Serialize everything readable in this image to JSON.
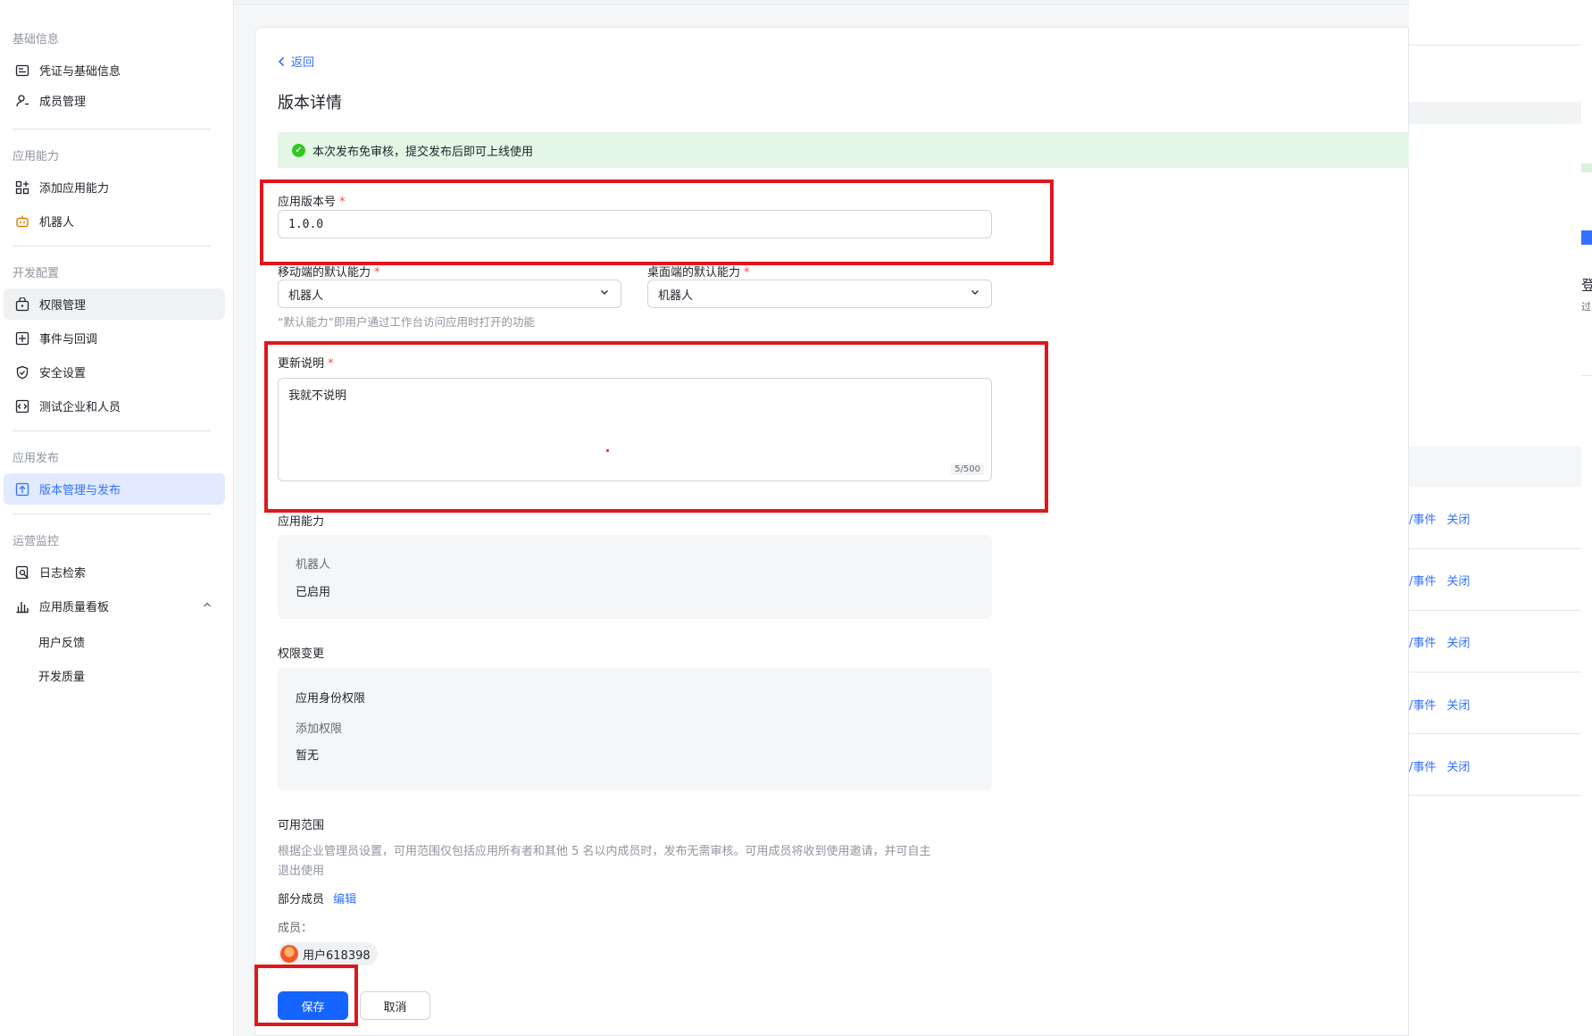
{
  "sidebar": {
    "sections": [
      {
        "title": "基础信息",
        "items": [
          {
            "label": "凭证与基础信息",
            "icon": "id-card-icon"
          },
          {
            "label": "成员管理",
            "icon": "person-icon"
          }
        ]
      },
      {
        "title": "应用能力",
        "items": [
          {
            "label": "添加应用能力",
            "icon": "apps-add-icon"
          },
          {
            "label": "机器人",
            "icon": "robot-icon"
          }
        ]
      },
      {
        "title": "开发配置",
        "items": [
          {
            "label": "权限管理",
            "icon": "lock-box-icon"
          },
          {
            "label": "事件与回调",
            "icon": "event-icon"
          },
          {
            "label": "安全设置",
            "icon": "shield-icon"
          },
          {
            "label": "测试企业和人员",
            "icon": "code-box-icon"
          }
        ]
      },
      {
        "title": "应用发布",
        "items": [
          {
            "label": "版本管理与发布",
            "icon": "upload-box-icon"
          }
        ]
      },
      {
        "title": "运营监控",
        "items": [
          {
            "label": "日志检索",
            "icon": "log-search-icon"
          },
          {
            "label": "应用质量看板",
            "icon": "bar-chart-icon"
          }
        ]
      }
    ],
    "subitems": [
      "用户反馈",
      "开发质量"
    ]
  },
  "main": {
    "back_label": "返回",
    "title": "版本详情",
    "notice": "本次发布免审核，提交发布后即可上线使用",
    "version": {
      "label": "应用版本号",
      "required_mark": "*",
      "value": "1.0.0"
    },
    "mobile_default": {
      "label": "移动端的默认能力",
      "required_mark": "*",
      "value": "机器人"
    },
    "desktop_default": {
      "label": "桌面端的默认能力",
      "required_mark": "*",
      "value": "机器人"
    },
    "default_hint": "“默认能力”即用户通过工作台访问应用时打开的功能",
    "update_notes": {
      "label": "更新说明",
      "required_mark": "*",
      "value": "我就不说明",
      "counter": "5/500"
    },
    "capabilities": {
      "label": "应用能力",
      "name": "机器人",
      "status": "已启用"
    },
    "permissions": {
      "label": "权限变更",
      "group": "应用身份权限",
      "sub": "添加权限",
      "value": "暂无"
    },
    "scope": {
      "label": "可用范围",
      "desc_line1": "根据企业管理员设置，可用范围仅包括应用所有者和其他 5 名以内成员时，发布无需审核。可用成员将收到使用邀请，并可自主",
      "desc_line2": "退出使用",
      "mode": "部分成员",
      "edit": "编辑",
      "members_label": "成员：",
      "member": "用户618398"
    },
    "save": "保存",
    "cancel": "取消"
  },
  "right_panel": {
    "rows": [
      "/事件",
      "/事件",
      "/事件",
      "/事件",
      "/事件"
    ],
    "close": "关闭",
    "frag1": "登",
    "frag2": "过"
  },
  "colors": {
    "accent": "#1664ff",
    "annotation": "#e0161d",
    "success": "#34c724"
  }
}
